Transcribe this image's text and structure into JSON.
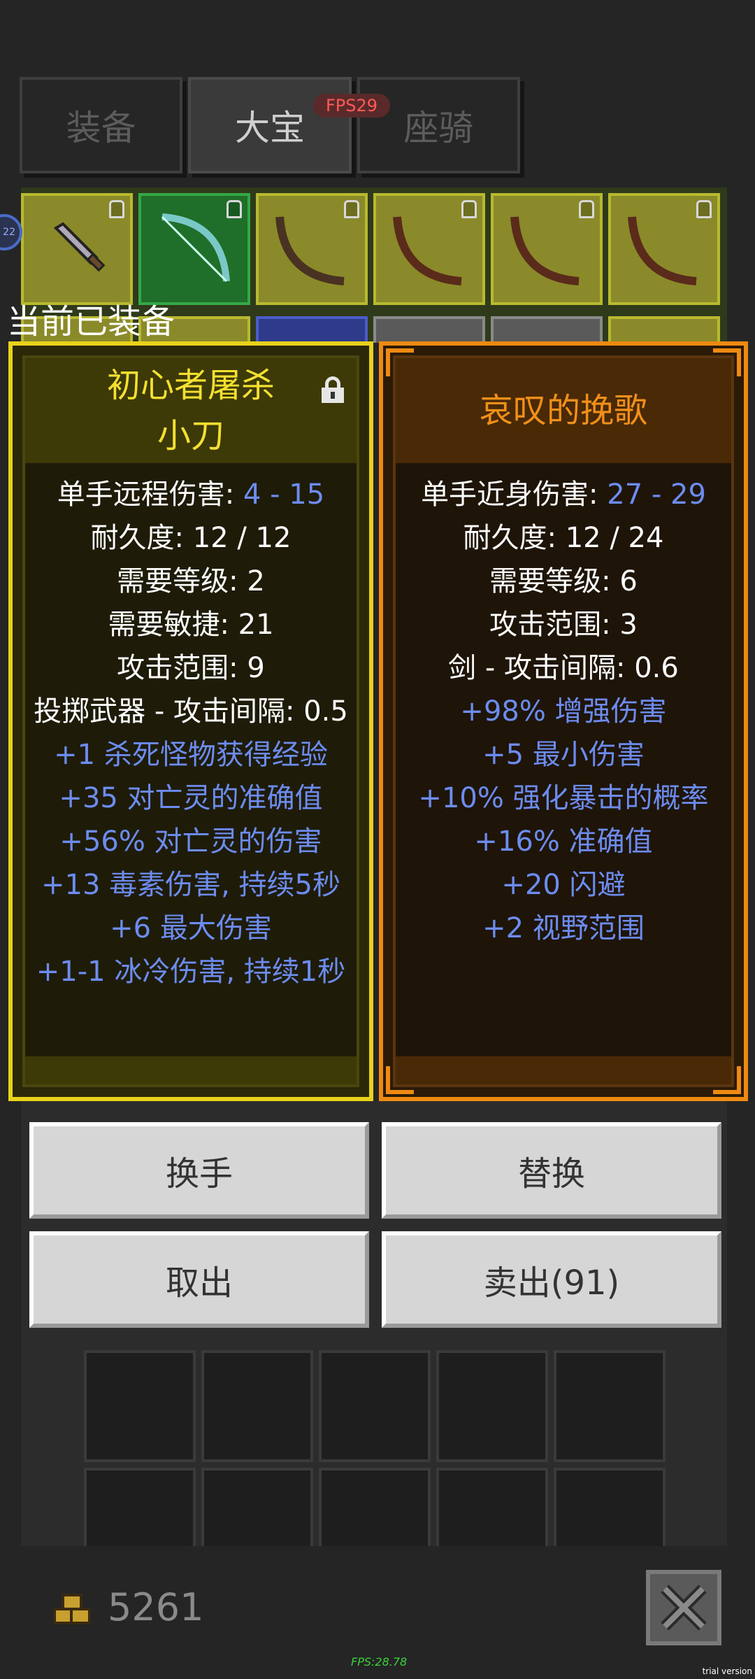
{
  "tabs": [
    {
      "label": "装备",
      "active": false
    },
    {
      "label": "大宝",
      "active": true
    },
    {
      "label": "座骑",
      "active": false
    }
  ],
  "fps_badge": "FPS29",
  "side_badge": "22",
  "equipped_label": "当前已装备",
  "left_item": {
    "name_line1": "初心者屠杀",
    "name_line2": "小刀",
    "locked": true,
    "stats": [
      {
        "label": "单手远程伤害: ",
        "value": "4 - 15"
      },
      {
        "label": "耐久度: 12 / 12"
      },
      {
        "label": "需要等级: 2"
      },
      {
        "label": "需要敏捷: 21"
      },
      {
        "label": "攻击范围: 9"
      },
      {
        "label": "投掷武器 - 攻击间隔: 0.5"
      }
    ],
    "bonuses": [
      "+1 杀死怪物获得经验",
      "+35 对亡灵的准确值",
      "+56% 对亡灵的伤害",
      "+13 毒素伤害, 持续5秒",
      "+6 最大伤害",
      "+1-1 冰冷伤害, 持续1秒"
    ]
  },
  "right_item": {
    "name": "哀叹的挽歌",
    "stats": [
      {
        "label": "单手近身伤害: ",
        "value": "27 - 29"
      },
      {
        "label": "耐久度: 12 / 24"
      },
      {
        "label": "需要等级: 6"
      },
      {
        "label": "攻击范围: 3"
      },
      {
        "label": "剑 - 攻击间隔: 0.6"
      }
    ],
    "bonuses": [
      "+98% 增强伤害",
      "+5 最小伤害",
      "+10% 强化暴击的概率",
      "+16% 准确值",
      "+20 闪避",
      "+2 视野范围"
    ]
  },
  "buttons": {
    "swap_hand": "换手",
    "replace": "替换",
    "take_out": "取出",
    "sell": "卖出(91)"
  },
  "gold": "5261",
  "fps_bottom": "FPS:28.78",
  "trial": "trial version",
  "colors": {
    "left_rarity": "#e8d21c",
    "right_rarity": "#ee8a12",
    "bonus_text": "#6c8cf0"
  }
}
